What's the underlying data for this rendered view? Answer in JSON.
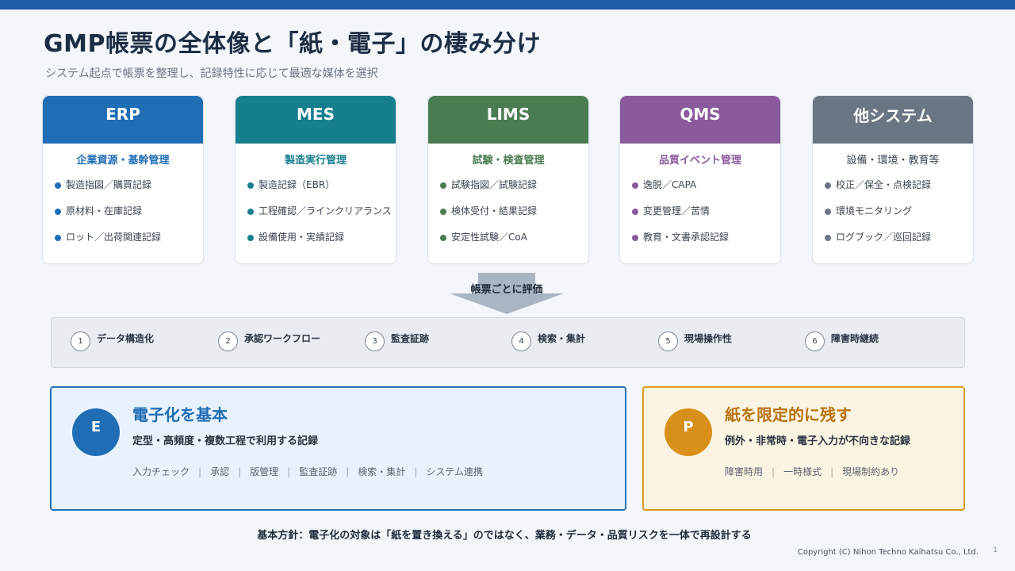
{
  "title": "GMP帳票の全体像と「紙・電子」の棲み分け",
  "subtitle": "システム起点で帳票を整理し、記録特性に応じて最適な媒体を選択",
  "systems": [
    {
      "name": "ERP",
      "subtitle": "企業資源・基幹管理",
      "color": "#1f6db5",
      "sub_color": "#1f6db5",
      "items": [
        "製造指図／購買記録",
        "原材料・在庫記録",
        "ロット／出荷関連記録"
      ]
    },
    {
      "name": "MES",
      "subtitle": "製造実行管理",
      "color": "#177e8e",
      "sub_color": "#177e8e",
      "items": [
        "製造記録（EBR）",
        "工程確認／ラインクリアランス",
        "設備使用・実績記録"
      ]
    },
    {
      "name": "LIMS",
      "subtitle": "試験・検査管理",
      "color": "#4a7c51",
      "sub_color": "#4a7c51",
      "items": [
        "試験指図／試験記録",
        "検体受付・結果記録",
        "安定性試験／CoA"
      ]
    },
    {
      "name": "QMS",
      "subtitle": "品質イベント管理",
      "color": "#8a5a9c",
      "sub_color": "#8a5a9c",
      "items": [
        "逸脱／CAPA",
        "変更管理／苦情",
        "教育・文書承認記録"
      ]
    },
    {
      "name": "他システム",
      "subtitle": "設備・環境・教育等",
      "color": "#6b7684",
      "sub_color": "#3a4452",
      "items": [
        "校正／保全・点検記録",
        "環境モニタリング",
        "ログブック／巡回記録"
      ]
    }
  ],
  "arrow_label": "帳票ごとに評価",
  "criteria": [
    {
      "num": "1",
      "label": "データ構造化"
    },
    {
      "num": "2",
      "label": "承認ワークフロー"
    },
    {
      "num": "3",
      "label": "監査証跡"
    },
    {
      "num": "4",
      "label": "検索・集計"
    },
    {
      "num": "5",
      "label": "現場操作性"
    },
    {
      "num": "6",
      "label": "障害時継続"
    }
  ],
  "electronic": {
    "badge": "E",
    "title": "電子化を基本",
    "desc": "定型・高頻度・複数工程で利用する記録",
    "tags": [
      "入力チェック",
      "承認",
      "版管理",
      "監査証跡",
      "検索・集計",
      "システム連携"
    ],
    "color": "#1f6db5"
  },
  "paper": {
    "badge": "P",
    "title": "紙を限定的に残す",
    "desc": "例外・非常時・電子入力が不向きな記録",
    "tags": [
      "障害時用",
      "一時様式",
      "現場制約あり"
    ],
    "color": "#d9901a",
    "title_color": "#b8720f"
  },
  "policy": "基本方針：電子化の対象は「紙を置き換える」のではなく、業務・データ・品質リスクを一体で再設計する",
  "copyright": "Copyright (C) Nihon Techno Kaihatsu Co., Ltd.",
  "page_number": "1"
}
